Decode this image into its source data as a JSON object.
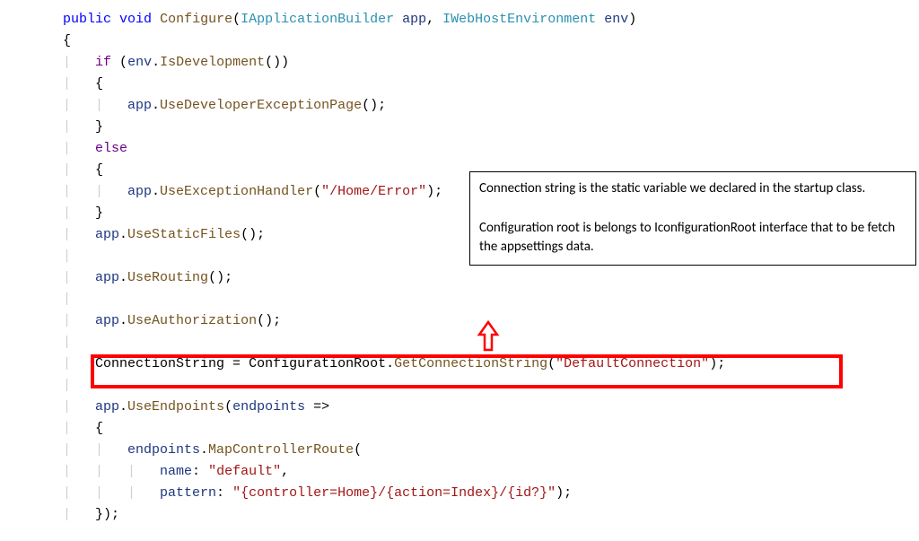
{
  "callout": {
    "para1": "Connection string is the static variable we declared in the startup class.",
    "para2": "Configuration root is belongs to IconfigurationRoot interface that to be fetch the appsettings data."
  },
  "tokens": {
    "kw_public": "public",
    "kw_void": "void",
    "kw_if": "if",
    "kw_else": "else",
    "method_configure": "Configure",
    "type_iappbuilder": "IApplicationBuilder",
    "type_iwebhost": "IWebHostEnvironment",
    "param_app": "app",
    "param_env": "env",
    "param_endpoints": "endpoints",
    "call_isdev": "IsDevelopment",
    "call_usedevexc": "UseDeveloperExceptionPage",
    "call_useexchandler": "UseExceptionHandler",
    "call_usestatic": "UseStaticFiles",
    "call_userouting": "UseRouting",
    "call_useauth": "UseAuthorization",
    "call_useendpoints": "UseEndpoints",
    "call_mapctrlroute": "MapControllerRoute",
    "call_getconnstr": "GetConnectionString",
    "prop_connstring": "ConnectionString",
    "prop_configroot": "ConfigurationRoot",
    "str_homeerror": "\"/Home/Error\"",
    "str_defaultconn": "\"DefaultConnection\"",
    "str_default": "\"default\"",
    "str_pattern": "\"{controller=Home}/{action=Index}/{id?}\"",
    "label_name": "name",
    "label_pattern": "pattern",
    "brace_open": "{",
    "brace_close": "}",
    "paren_open": "(",
    "paren_close": ")",
    "paren_close_semi": ");",
    "paren_close_paren": "()",
    "paren_close_paren_semi": "();",
    "comma": ",",
    "comma_sp": ", ",
    "dot": ".",
    "colon_sp": ": ",
    "eq": " = ",
    "arrow": " =>",
    "brace_close_paren_semi": "});"
  }
}
